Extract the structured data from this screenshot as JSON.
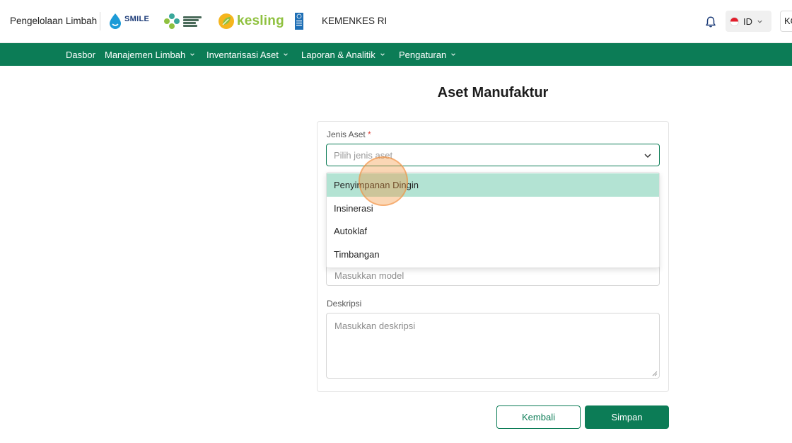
{
  "header": {
    "app_title": "Pengelolaan Limbah",
    "org_label": "KEMENKES RI",
    "logos": {
      "smile": {
        "word": "SMILE",
        "icon": "water-drop-icon",
        "color": "#1d3c78"
      },
      "kemenkes": {
        "icon": "kemenkes-logo-icon",
        "color": "#3aa89b"
      },
      "kesling": {
        "word": "kesling",
        "icon": "leaf-icon",
        "color": "#8fc13f"
      },
      "undp": {
        "icon": "undp-logo-icon",
        "color": "#1f6fb5"
      }
    },
    "notification_icon": "bell-icon",
    "language": {
      "code": "ID",
      "flag_colors": [
        "#e21d2b",
        "#ffffff"
      ]
    },
    "user_chip": "KO"
  },
  "nav": {
    "items": [
      {
        "label": "Dasbor",
        "has_dropdown": false
      },
      {
        "label": "Manajemen Limbah",
        "has_dropdown": true
      },
      {
        "label": "Inventarisasi Aset",
        "has_dropdown": true
      },
      {
        "label": "Laporan & Analitik",
        "has_dropdown": true
      },
      {
        "label": "Pengaturan",
        "has_dropdown": true
      }
    ],
    "background": "#0c7c56"
  },
  "page": {
    "title": "Aset Manufaktur"
  },
  "form": {
    "asset_type": {
      "label": "Jenis Aset",
      "required_mark": "*",
      "placeholder": "Pilih jenis aset",
      "options": [
        {
          "label": "Penyimpanan Dingin",
          "highlighted": true
        },
        {
          "label": "Insinerasi",
          "highlighted": false
        },
        {
          "label": "Autoklaf",
          "highlighted": false
        },
        {
          "label": "Timbangan",
          "highlighted": false
        }
      ]
    },
    "model": {
      "placeholder": "Masukkan model"
    },
    "description": {
      "label": "Deskripsi",
      "placeholder": "Masukkan deskripsi"
    }
  },
  "actions": {
    "back_label": "Kembali",
    "save_label": "Simpan"
  },
  "colors": {
    "primary": "#0c7c56",
    "option_highlight": "#b3e3d3",
    "required": "#e0413a"
  }
}
